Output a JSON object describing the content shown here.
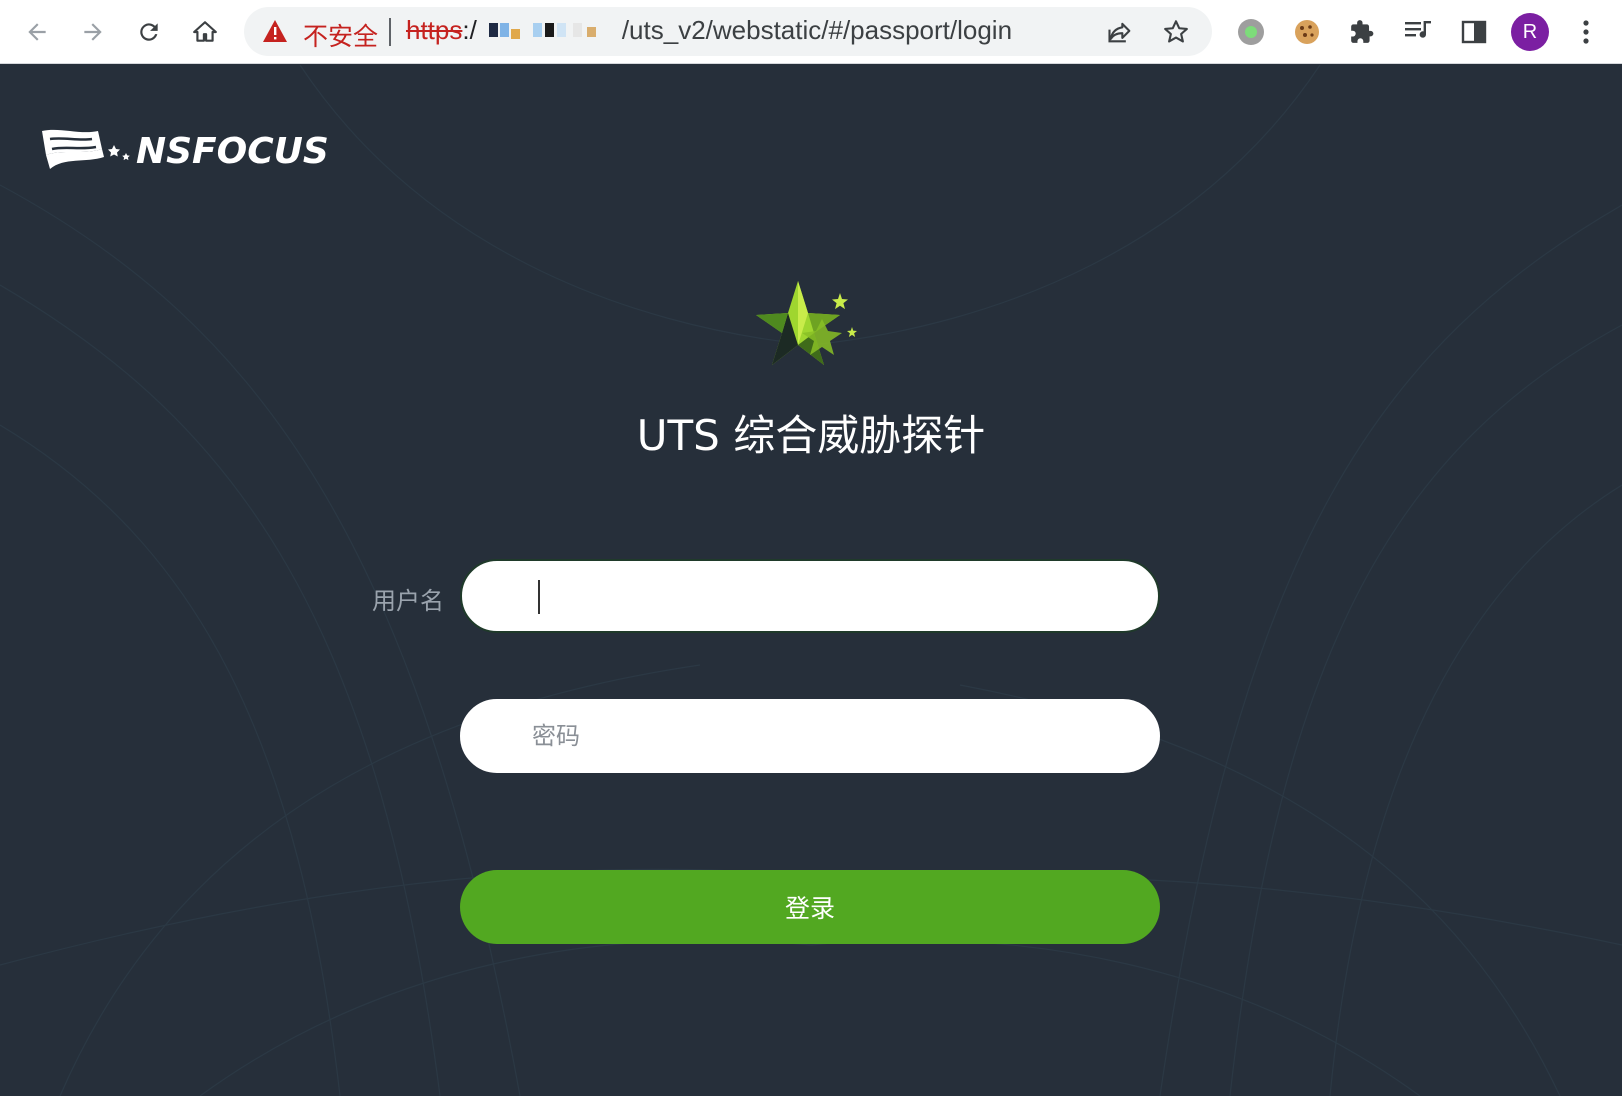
{
  "browser": {
    "security_label": "不安全",
    "url_scheme": "https",
    "url_sep": ":/",
    "url_path": "/uts_v2/webstatic/#/passport/login",
    "profile_initial": "R",
    "icons": [
      "back-icon",
      "forward-icon",
      "reload-icon",
      "home-icon",
      "warning-icon",
      "share-icon",
      "bookmark-star-icon",
      "extension-circle-icon",
      "cookie-icon",
      "puzzle-icon",
      "reading-list-icon",
      "side-panel-icon",
      "menu-icon"
    ]
  },
  "page": {
    "brand": "NSFOCUS",
    "title": "UTS 综合威胁探针",
    "username_label": "用户名",
    "username_value": "",
    "password_placeholder": "密码",
    "login_label": "登录"
  },
  "colors": {
    "background": "#262f3a",
    "login_button": "#52a821",
    "insecure_text": "#c5221f",
    "avatar": "#7b1fa2"
  }
}
